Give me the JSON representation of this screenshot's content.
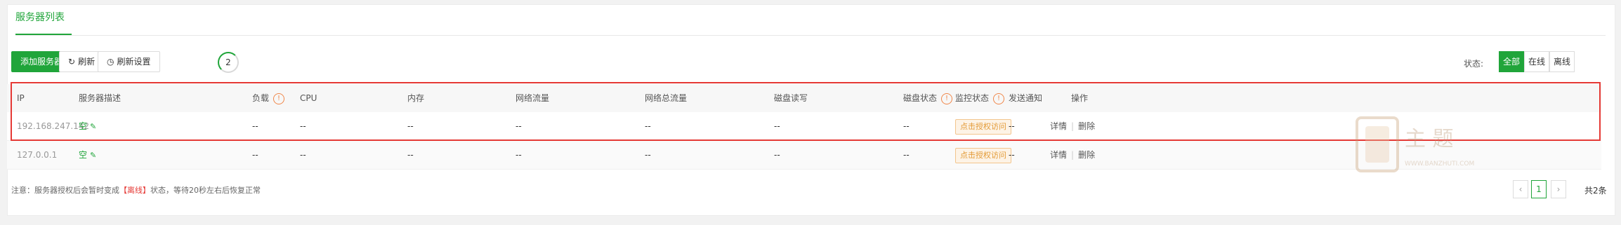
{
  "tabs": {
    "active": "服务器列表"
  },
  "toolbar": {
    "add_label": "添加服务器",
    "refresh_label": "刷新",
    "refresh_settings_label": "刷新设置",
    "countdown": "2",
    "status_label": "状态:",
    "filters": [
      "全部",
      "在线",
      "离线"
    ],
    "active_filter": "全部"
  },
  "table": {
    "headers": {
      "ip": "IP",
      "desc": "服务器描述",
      "load": "负载",
      "cpu": "CPU",
      "mem": "内存",
      "net": "网络流量",
      "net_total": "网络总流量",
      "disk_rw": "磁盘读写",
      "disk_status": "磁盘状态",
      "monitor": "监控状态",
      "notify": "发送通知",
      "action": "操作"
    },
    "rows": [
      {
        "ip": "192.168.247.142",
        "desc": "空",
        "load": "--",
        "cpu": "--",
        "mem": "--",
        "net": "--",
        "net_total": "--",
        "disk_rw": "--",
        "disk_status": "--",
        "monitor": "点击授权访问",
        "notify": "--",
        "detail": "详情",
        "delete": "删除"
      },
      {
        "ip": "127.0.0.1",
        "desc": "空",
        "load": "--",
        "cpu": "--",
        "mem": "--",
        "net": "--",
        "net_total": "--",
        "disk_rw": "--",
        "disk_status": "--",
        "monitor": "点击授权访问",
        "notify": "--",
        "detail": "详情",
        "delete": "删除"
      }
    ]
  },
  "footer": {
    "note_prefix": "注意：服务器授权后会暂时变成",
    "note_offline": "【离线】",
    "note_suffix": "状态，等待20秒左右后恢复正常",
    "current_page": "1",
    "prev": "‹",
    "next": "›",
    "total": "共2条"
  },
  "watermark": {
    "text": "主 题",
    "url": "WWW.BANZHUTI.COM"
  },
  "colors": {
    "accent": "#20a53a",
    "highlight": "#e53935",
    "warning": "#f0874a"
  }
}
